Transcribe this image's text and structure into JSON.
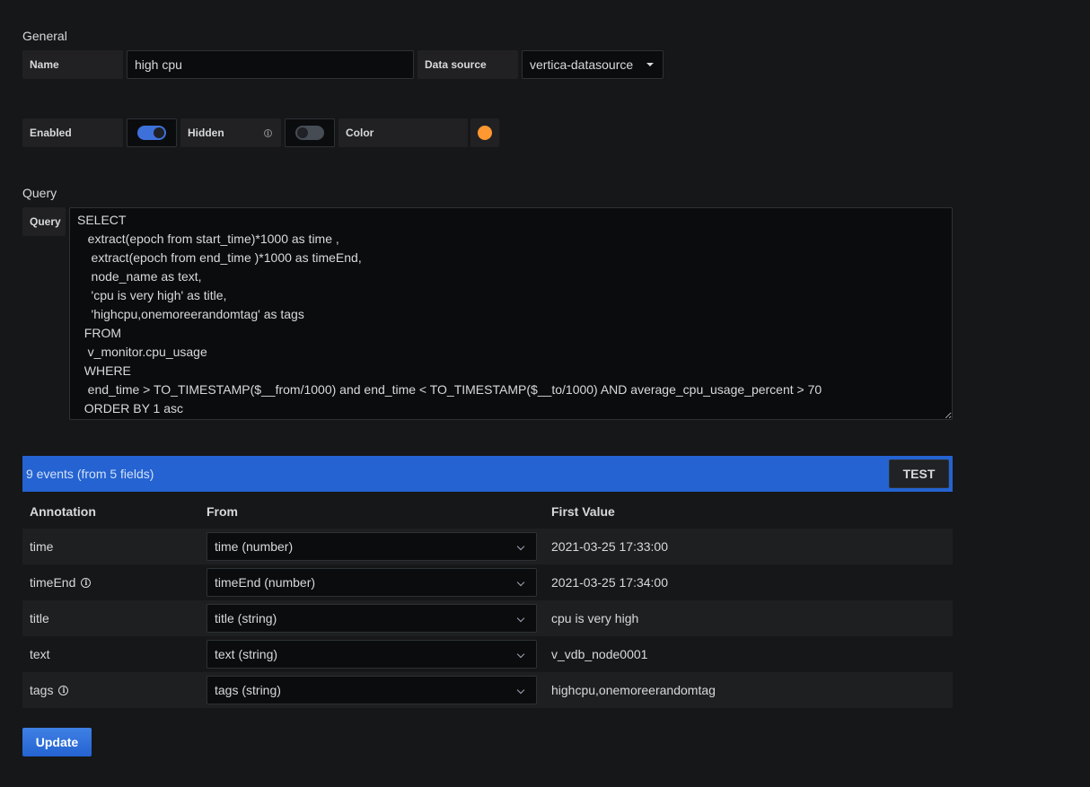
{
  "general": {
    "section_title": "General",
    "name_label": "Name",
    "name_value": "high cpu",
    "datasource_label": "Data source",
    "datasource_value": "vertica-datasource",
    "enabled_label": "Enabled",
    "enabled": true,
    "hidden_label": "Hidden",
    "hidden": false,
    "color_label": "Color",
    "color": "#ff9830"
  },
  "query": {
    "section_title": "Query",
    "label": "Query",
    "text": "SELECT\n   extract(epoch from start_time)*1000 as time ,\n    extract(epoch from end_time )*1000 as timeEnd,\n    node_name as text,\n    'cpu is very high' as title,\n    'highcpu,onemoreerandomtag' as tags\n  FROM\n   v_monitor.cpu_usage\n  WHERE\n   end_time > TO_TIMESTAMP($__from/1000) and end_time < TO_TIMESTAMP($__to/1000) AND average_cpu_usage_percent > 70\n  ORDER BY 1 asc"
  },
  "results": {
    "summary": "9 events (from 5 fields)",
    "test_label": "TEST",
    "banner_color": "#2463d1"
  },
  "table": {
    "headers": [
      "Annotation",
      "From",
      "First Value"
    ],
    "rows": [
      {
        "name": "time",
        "from": "time (number)",
        "value": "2021-03-25 17:33:00",
        "info": false
      },
      {
        "name": "timeEnd",
        "from": "timeEnd (number)",
        "value": "2021-03-25 17:34:00",
        "info": true
      },
      {
        "name": "title",
        "from": "title (string)",
        "value": "cpu is very high",
        "info": false
      },
      {
        "name": "text",
        "from": "text (string)",
        "value": "v_vdb_node0001",
        "info": false
      },
      {
        "name": "tags",
        "from": "tags (string)",
        "value": "highcpu,onemoreerandomtag",
        "info": true
      }
    ]
  },
  "update_label": "Update"
}
